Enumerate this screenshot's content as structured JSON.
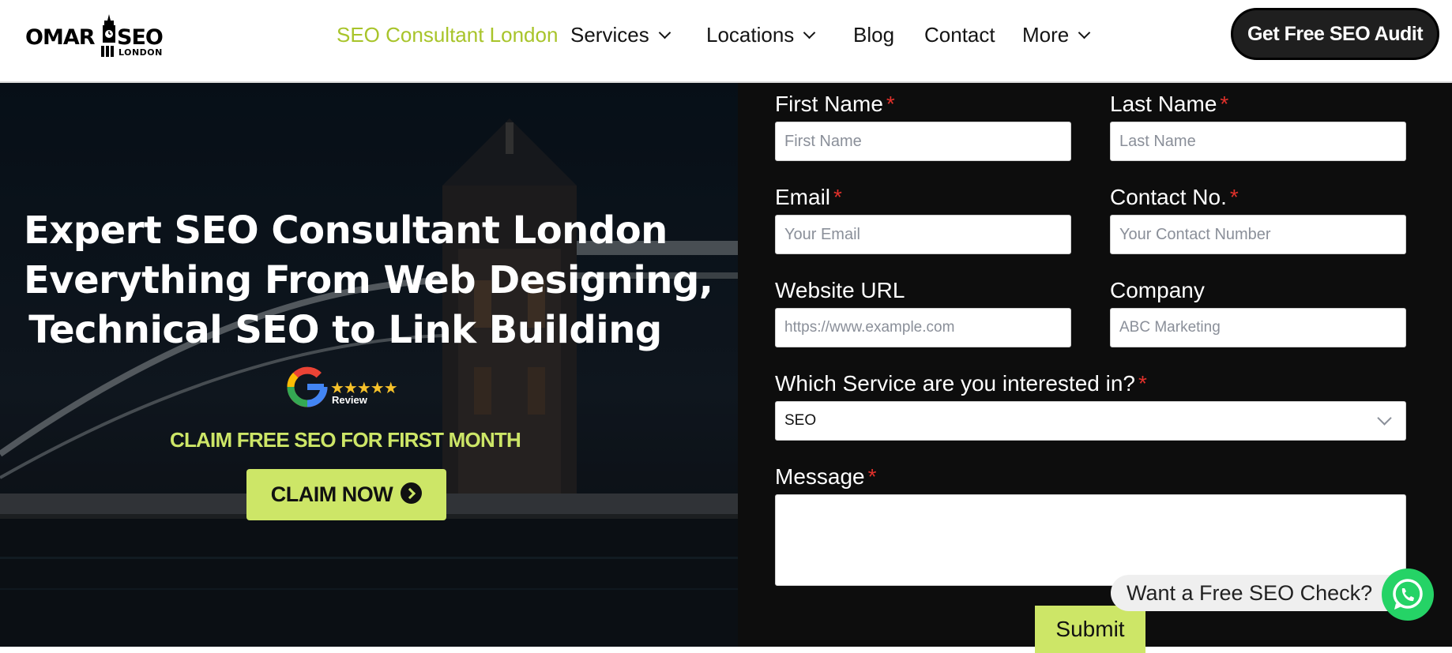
{
  "logo": {
    "left": "OMAR",
    "right": "SEO",
    "sub": "LONDON"
  },
  "nav": {
    "items": [
      {
        "label": "SEO Consultant London",
        "active": true,
        "dropdown": false
      },
      {
        "label": "Services",
        "active": false,
        "dropdown": true
      },
      {
        "label": "Locations",
        "active": false,
        "dropdown": true
      },
      {
        "label": "Blog",
        "active": false,
        "dropdown": false
      },
      {
        "label": "Contact",
        "active": false,
        "dropdown": false
      },
      {
        "label": "More",
        "active": false,
        "dropdown": true
      }
    ],
    "cta_label": "Get Free SEO Audit"
  },
  "hero": {
    "title_lines": [
      "Expert SEO Consultant London",
      "Everything From Web Designing,",
      "Technical SEO to Link Building"
    ],
    "review_stars": "★★★★★",
    "review_label": "Review",
    "claim_text": "CLAIM FREE SEO FOR FIRST MONTH",
    "claim_button": "CLAIM NOW"
  },
  "form": {
    "first_name": {
      "label": "First Name",
      "required": "*",
      "placeholder": "First Name"
    },
    "last_name": {
      "label": "Last Name",
      "required": "*",
      "placeholder": "Last Name"
    },
    "email": {
      "label": "Email",
      "required": "*",
      "placeholder": "Your Email"
    },
    "contact": {
      "label": "Contact No.",
      "required": "*",
      "placeholder": "Your Contact Number"
    },
    "website": {
      "label": "Website URL",
      "placeholder": "https://www.example.com"
    },
    "company": {
      "label": "Company",
      "placeholder": "ABC Marketing"
    },
    "service": {
      "label": "Which Service are you interested in?",
      "required": "*",
      "selected": "SEO"
    },
    "message": {
      "label": "Message",
      "required": "*"
    },
    "submit_label": "Submit"
  },
  "chat": {
    "bubble_text": "Want a Free SEO Check?"
  },
  "colors": {
    "accent": "#cde667",
    "nav_active": "#a8c42a",
    "required": "#e0312b",
    "whatsapp": "#25d366"
  }
}
